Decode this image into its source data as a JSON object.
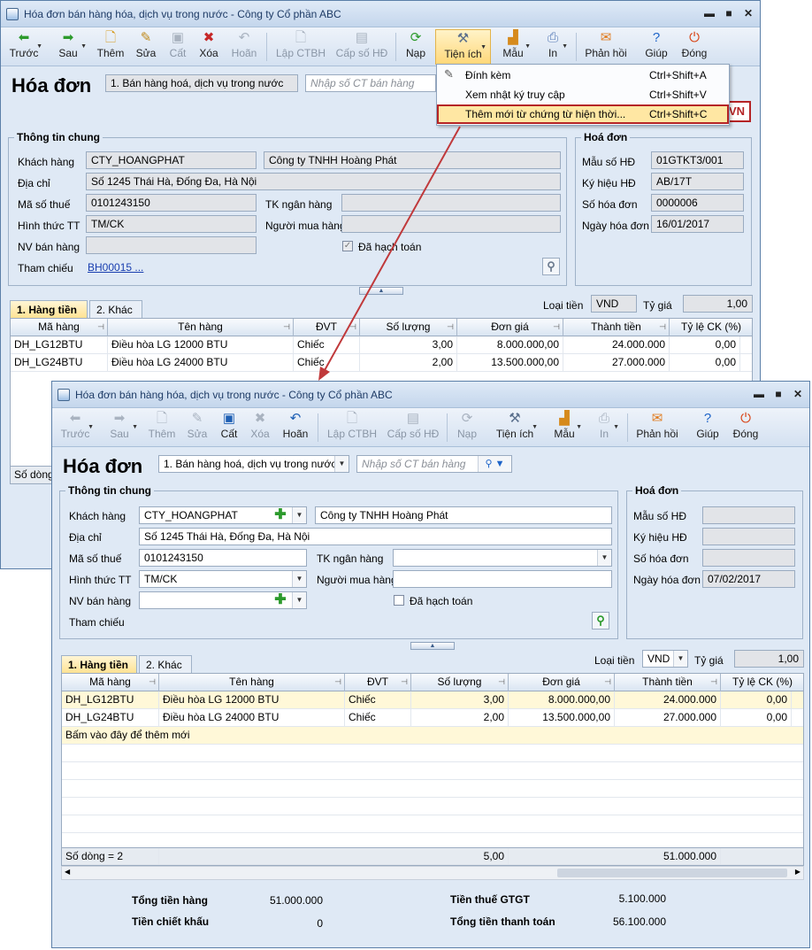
{
  "window": {
    "title": "Hóa đơn bán hàng hóa, dịch vụ trong nước - Công ty Cổ phần ABC",
    "minimize": "▬",
    "maximize": "■",
    "close": "✕"
  },
  "toolbar": {
    "prev": "Trước",
    "next": "Sau",
    "add": "Thêm",
    "edit": "Sửa",
    "save": "Cất",
    "delete": "Xóa",
    "undo": "Hoãn",
    "ctbh": "Lập CTBH",
    "hd": "Cấp số HĐ",
    "load": "Nạp",
    "utilities": "Tiện ích",
    "template": "Mẫu",
    "print": "In",
    "feedback": "Phản hồi",
    "help": "Giúp",
    "close": "Đóng"
  },
  "utilities_menu": [
    {
      "label": "Đính kèm",
      "shortcut": "Ctrl+Shift+A"
    },
    {
      "label": "Xem nhật ký truy cập",
      "shortcut": "Ctrl+Shift+V"
    },
    {
      "label": "Thêm mới từ chứng từ hiện thời...",
      "shortcut": "Ctrl+Shift+C"
    }
  ],
  "back_badge": "VN",
  "form": {
    "title": "Hóa đơn",
    "invoice_type": "1. Bán hàng hoá, dịch vụ trong nước",
    "search_placeholder": "Nhập số CT bán hàng",
    "general_title": "Thông tin chung",
    "customer_label": "Khách hàng",
    "customer_code": "CTY_HOANGPHAT",
    "customer_name": "Công ty TNHH Hoàng Phát",
    "address_label": "Địa chỉ",
    "address": "Số 1245 Thái Hà, Đống Đa, Hà Nội",
    "tax_label": "Mã số thuế",
    "tax": "0101243150",
    "bank_label": "TK ngân hàng",
    "payment_label": "Hình thức TT",
    "payment": "TM/CK",
    "buyer_label": "Người mua hàng",
    "seller_label": "NV bán hàng",
    "posted_label": "Đã hạch toán",
    "ref_label": "Tham chiếu",
    "ref_value": "BH00015 ...",
    "invoice_title": "Hoá đơn",
    "form_no_label": "Mẫu số HĐ",
    "symbol_label": "Ký hiệu HĐ",
    "invoice_no_label": "Số hóa đơn",
    "date_label": "Ngày hóa đơn",
    "back_form_no": "01GTKT3/001",
    "back_symbol": "AB/17T",
    "back_invoice_no": "0000006",
    "back_date": "16/01/2017",
    "front_date": "07/02/2017",
    "currency_label": "Loại tiền",
    "currency": "VND",
    "rate_label": "Tỷ giá",
    "rate": "1,00",
    "tab1": "1. Hàng tiền",
    "tab2": "2. Khác"
  },
  "grid": {
    "columns": [
      "Mã hàng",
      "Tên hàng",
      "ĐVT",
      "Số lượng",
      "Đơn giá",
      "Thành tiền",
      "Tỷ lệ CK (%)"
    ],
    "rows": [
      [
        "DH_LG12BTU",
        "Điều hòa LG 12000 BTU",
        "Chiếc",
        "3,00",
        "8.000.000,00",
        "24.000.000",
        "0,00"
      ],
      [
        "DH_LG24BTU",
        "Điều hòa LG 24000 BTU",
        "Chiếc",
        "2,00",
        "13.500.000,00",
        "27.000.000",
        "0,00"
      ]
    ],
    "add_row_hint": "Bấm vào đây để thêm mới",
    "back_footer": "Số dòng",
    "footer_count": "Số dòng = 2",
    "footer_qty": "5,00",
    "footer_total": "51.000.000"
  },
  "totals": {
    "goods_label": "Tổng tiền hàng",
    "goods": "51.000.000",
    "discount_label": "Tiền chiết khấu",
    "discount": "0",
    "vat_label": "Tiền thuế GTGT",
    "vat": "5.100.000",
    "payment_label": "Tổng tiền thanh toán",
    "payment": "56.100.000"
  }
}
